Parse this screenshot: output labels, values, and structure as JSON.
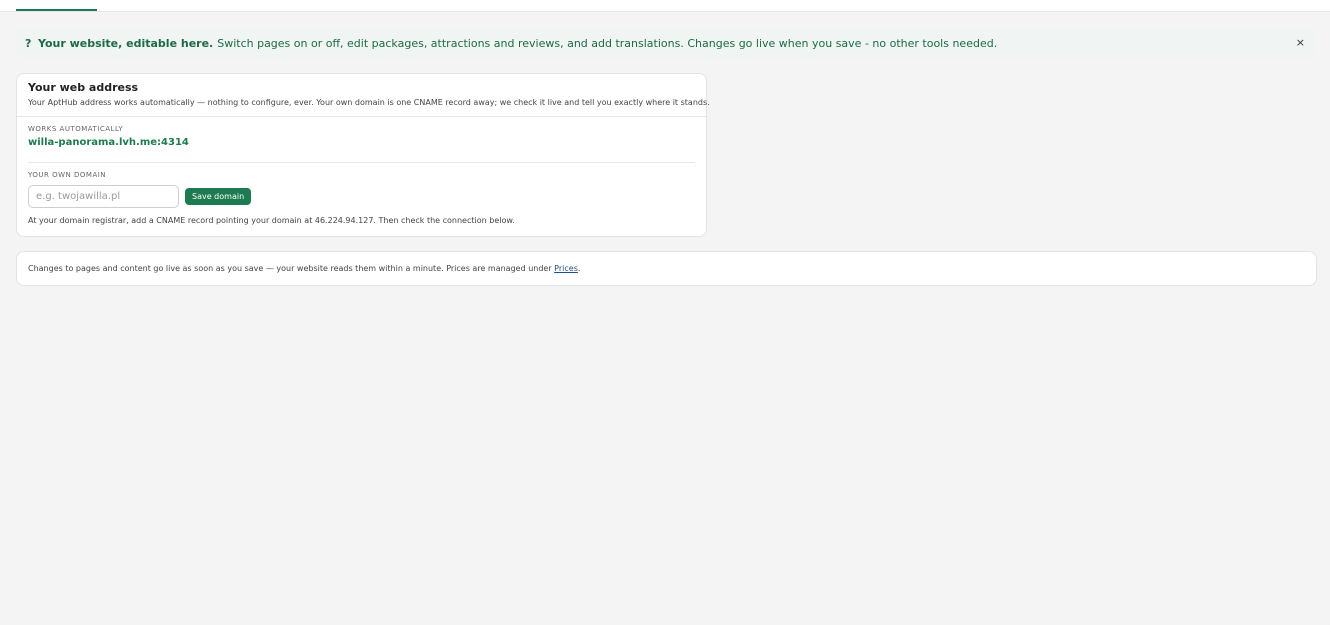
{
  "banner": {
    "help_glyph": "?",
    "strong": "Your website, editable here.",
    "text": "Switch pages on or off, edit packages, attractions and reviews, and add translations. Changes go live when you save - no other tools needed.",
    "close_glyph": "×"
  },
  "domain_card": {
    "title": "Your web address",
    "description": "Your AptHub address works automatically — nothing to configure, ever. Your own domain is one CNAME record away; we check it live and tell you exactly where it stands.",
    "auto_label": "WORKS AUTOMATICALLY",
    "auto_domain": "willa-panorama.lvh.me:4314",
    "own_label": "YOUR OWN DOMAIN",
    "input_placeholder": "e.g. twojawilla.pl",
    "input_value": "",
    "save_label": "Save domain",
    "hint": "At your domain registrar, add a CNAME record pointing your domain at 46.224.94.127. Then check the connection below."
  },
  "note_card": {
    "text": "Changes to pages and content go live as soon as you save — your website reads them within a minute. Prices are managed under ",
    "link": "Prices",
    "suffix": "."
  },
  "colors": {
    "accent": "#1e7a50",
    "banner_bg": "#f0f4f2",
    "link": "#1d4e8f",
    "page_bg": "#f4f4f4"
  }
}
